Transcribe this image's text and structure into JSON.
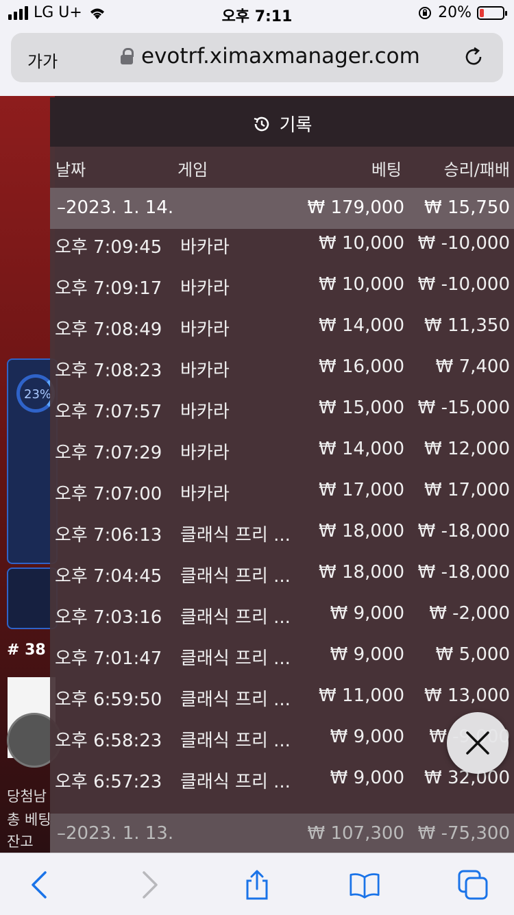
{
  "status_bar": {
    "carrier": "LG U+",
    "time": "오후 7:11",
    "battery_percent": "20%",
    "battery_level": 0.2
  },
  "browser": {
    "text_size_button": "가가",
    "url": "evotrf.ximaxmanager.com"
  },
  "background": {
    "progress_label": "23%",
    "table_number": "# 38",
    "line1": "당첨남",
    "line2": "총 베팅",
    "line3": "잔고"
  },
  "panel": {
    "title": "기록",
    "columns": {
      "date": "날짜",
      "game": "게임",
      "bet": "베팅",
      "win_loss": "승리/패배"
    },
    "current_day": {
      "date": "–2023. 1. 14.",
      "bet": "₩ 179,000",
      "win_loss": "₩ 15,750"
    },
    "rows": [
      {
        "time": "오후 7:09:45",
        "game": "바카라",
        "bet": "₩ 10,000",
        "win_loss": "₩ -10,000"
      },
      {
        "time": "오후 7:09:17",
        "game": "바카라",
        "bet": "₩ 10,000",
        "win_loss": "₩ -10,000"
      },
      {
        "time": "오후 7:08:49",
        "game": "바카라",
        "bet": "₩ 14,000",
        "win_loss": "₩ 11,350"
      },
      {
        "time": "오후 7:08:23",
        "game": "바카라",
        "bet": "₩ 16,000",
        "win_loss": "₩ 7,400"
      },
      {
        "time": "오후 7:07:57",
        "game": "바카라",
        "bet": "₩ 15,000",
        "win_loss": "₩ -15,000"
      },
      {
        "time": "오후 7:07:29",
        "game": "바카라",
        "bet": "₩ 14,000",
        "win_loss": "₩ 12,000"
      },
      {
        "time": "오후 7:07:00",
        "game": "바카라",
        "bet": "₩ 17,000",
        "win_loss": "₩ 17,000"
      },
      {
        "time": "오후 7:06:13",
        "game": "클래식 프리 ...",
        "bet": "₩ 18,000",
        "win_loss": "₩ -18,000"
      },
      {
        "time": "오후 7:04:45",
        "game": "클래식 프리 ...",
        "bet": "₩ 18,000",
        "win_loss": "₩ -18,000"
      },
      {
        "time": "오후 7:03:16",
        "game": "클래식 프리 ...",
        "bet": "₩ 9,000",
        "win_loss": "₩ -2,000"
      },
      {
        "time": "오후 7:01:47",
        "game": "클래식 프리 ...",
        "bet": "₩ 9,000",
        "win_loss": "₩ 5,000"
      },
      {
        "time": "오후 6:59:50",
        "game": "클래식 프리 ...",
        "bet": "₩ 11,000",
        "win_loss": "₩ 13,000"
      },
      {
        "time": "오후 6:58:23",
        "game": "클래식 프리 ...",
        "bet": "₩ 9,000",
        "win_loss": "₩ -9,000"
      },
      {
        "time": "오후 6:57:23",
        "game": "클래식 프리 ...",
        "bet": "₩ 9,000",
        "win_loss": "₩ 32,000"
      }
    ],
    "previous_day": {
      "date": "–2023. 1. 13.",
      "bet": "₩ 107,300",
      "win_loss": "₩ -75,300"
    }
  },
  "icons": {
    "history": "history-icon",
    "close": "close-icon",
    "back": "back-chevron-icon",
    "forward": "forward-chevron-icon",
    "share": "share-icon",
    "bookmarks": "book-icon",
    "tabs": "tabs-icon"
  },
  "colors": {
    "accent": "#1a73e8",
    "battery_low": "#e53935"
  }
}
